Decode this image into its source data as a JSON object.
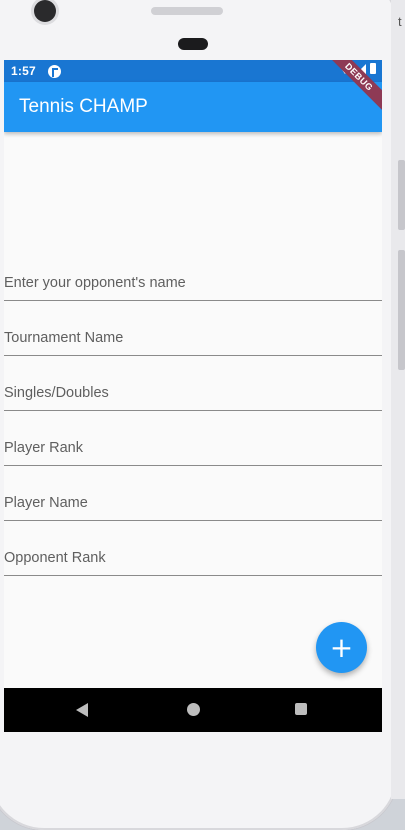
{
  "status_bar": {
    "time": "1:57"
  },
  "app_bar": {
    "title": "Tennis CHAMP",
    "debug_banner": "DEBUG"
  },
  "form": {
    "fields": [
      {
        "placeholder": "Enter your opponent's name",
        "value": ""
      },
      {
        "placeholder": "Tournament Name",
        "value": ""
      },
      {
        "placeholder": "Singles/Doubles",
        "value": ""
      },
      {
        "placeholder": "Player Rank",
        "value": ""
      },
      {
        "placeholder": "Player Name",
        "value": ""
      },
      {
        "placeholder": "Opponent Rank",
        "value": ""
      }
    ]
  },
  "fab": {
    "label": "+"
  },
  "side_peek": {
    "text": "t"
  },
  "colors": {
    "primary": "#2196f3",
    "primary_dark": "#1976d2",
    "debug_ribbon": "#8e3a55"
  },
  "icons": {
    "fab": "add-icon",
    "nav_back": "back-triangle-icon",
    "nav_home": "home-circle-icon",
    "nav_recent": "recents-square-icon"
  }
}
